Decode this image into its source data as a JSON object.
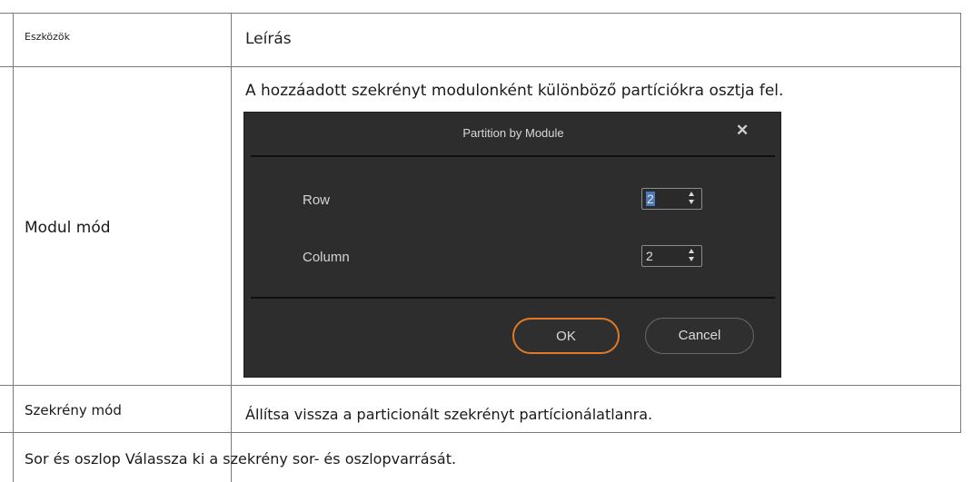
{
  "table": {
    "header": {
      "tools": "Eszközök",
      "description": "Leírás"
    },
    "rows": [
      {
        "tool": "Modul mód",
        "description": "A hozzáadott szekrényt modulonként különböző partíciókra osztja fel."
      },
      {
        "tool": "Szekrény mód",
        "description": "Állítsa vissza a particionált szekrényt partícionálatlanra."
      },
      {
        "text": "Sor és oszlop Válassza ki a szekrény sor- és oszlopvarrását."
      }
    ]
  },
  "dialog": {
    "title": "Partition by Module",
    "close_icon": "close-icon",
    "row_label": "Row",
    "row_value": "2",
    "column_label": "Column",
    "column_value": "2",
    "ok_label": "OK",
    "cancel_label": "Cancel",
    "colors": {
      "background": "#2d2d2d",
      "ok_border": "#e07a28",
      "selection": "#4a78b8"
    }
  }
}
